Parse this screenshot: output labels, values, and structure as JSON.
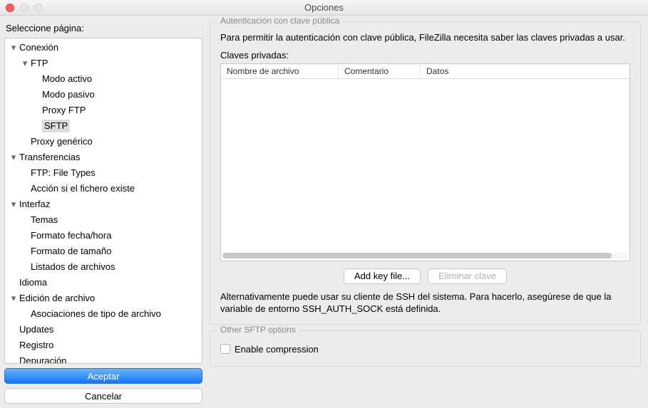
{
  "window": {
    "title": "Opciones"
  },
  "sidebar": {
    "heading": "Seleccione página:",
    "accept": "Aceptar",
    "cancel": "Cancelar",
    "tree": {
      "connection": "Conexión",
      "ftp": "FTP",
      "ftp_active": "Modo activo",
      "ftp_passive": "Modo pasivo",
      "ftp_proxy": "Proxy FTP",
      "sftp": "SFTP",
      "generic_proxy": "Proxy genérico",
      "transfers": "Transferencias",
      "ftp_file_types": "FTP: File Types",
      "file_exists": "Acción si el fichero existe",
      "interface": "Interfaz",
      "themes": "Temas",
      "date_format": "Formato fecha/hora",
      "size_format": "Formato de tamaño",
      "file_listings": "Listados de archivos",
      "language": "Idioma",
      "file_editing": "Edición de archivo",
      "associations": "Asociaciones de tipo de archivo",
      "updates": "Updates",
      "logging": "Registro",
      "debugging": "Depuración"
    }
  },
  "main": {
    "group1_title": "Autenticación con clave pública",
    "para1": "Para permitir la autenticación con clave pública, FileZilla necesita saber las claves privadas a usar.",
    "private_keys_label": "Claves privadas:",
    "columns": {
      "filename": "Nombre de archivo",
      "comment": "Comentario",
      "data": "Datos"
    },
    "add_key": "Add key file...",
    "remove_key": "Eliminar clave",
    "para2": "Alternativamente puede usar su cliente de SSH del sistema. Para hacerlo, asegúrese de que la variable de entorno SSH_AUTH_SOCK está definida.",
    "group2_title": "Other SFTP options",
    "enable_compression": "Enable compression"
  }
}
